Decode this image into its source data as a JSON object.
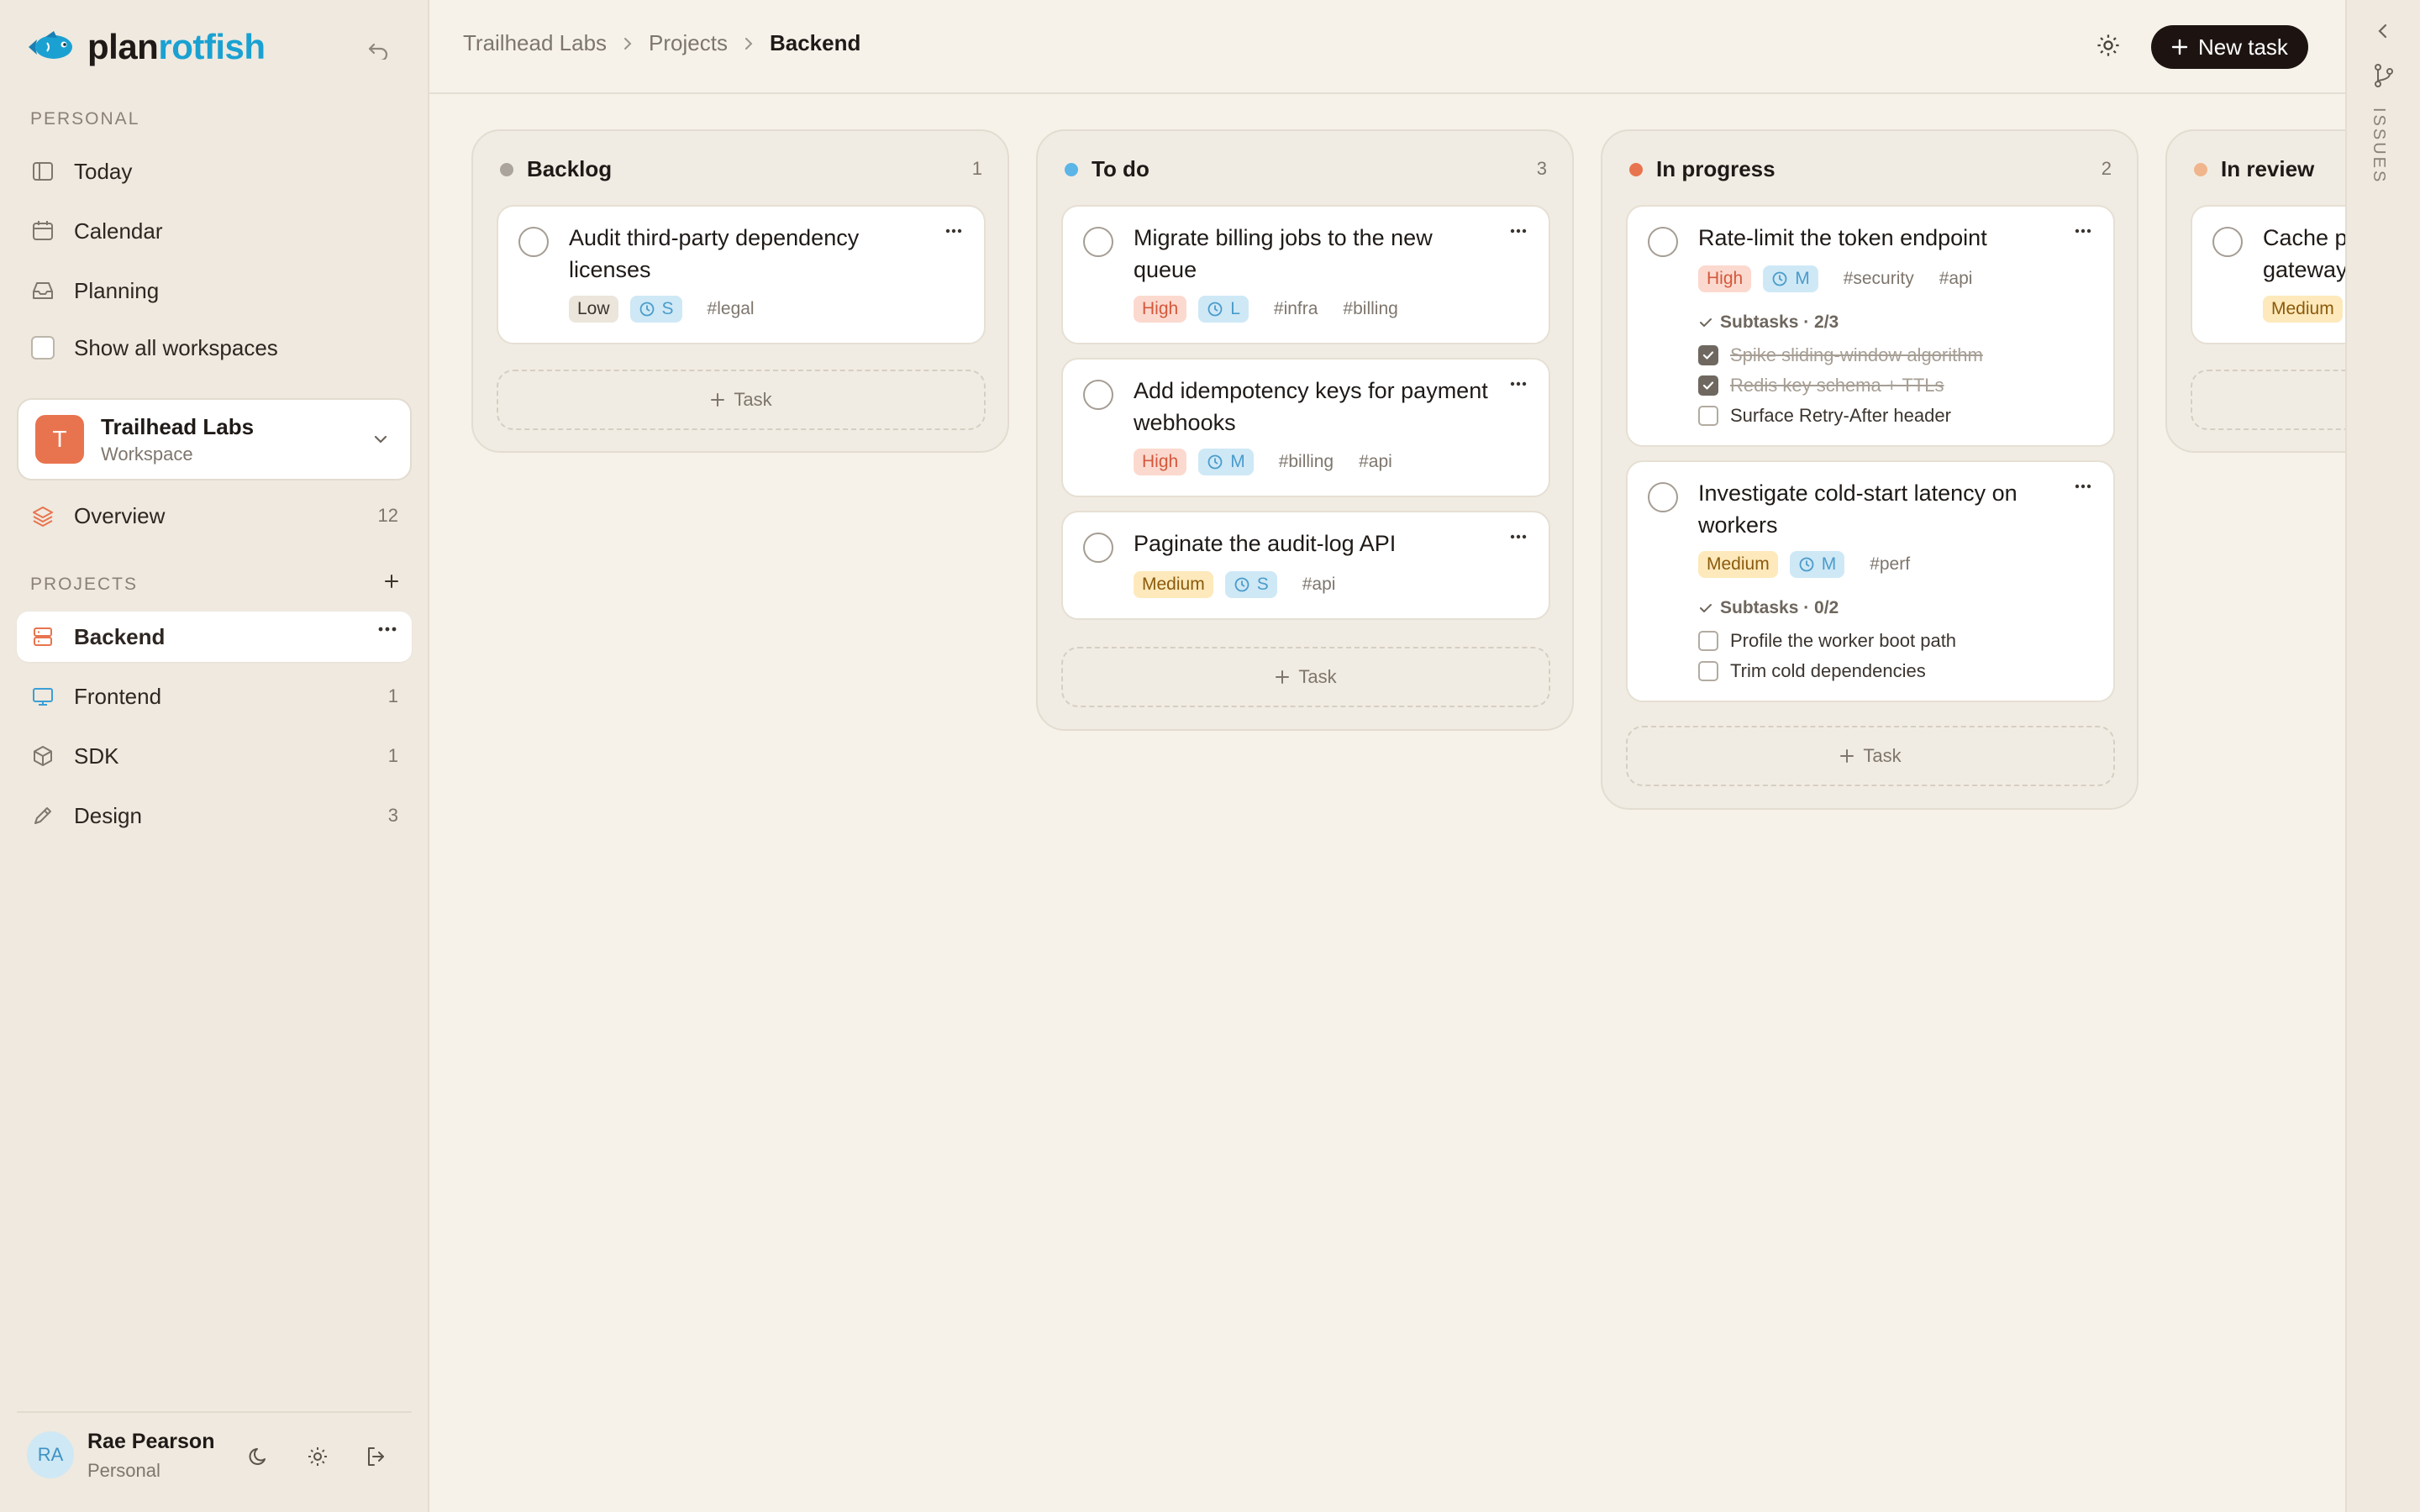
{
  "app": {
    "logo_part1": "plan",
    "logo_part2": "rotfish"
  },
  "sidebar": {
    "personal_label": "PERSONAL",
    "personal_items": [
      {
        "label": "Today",
        "icon": "sidebar-panel-icon"
      },
      {
        "label": "Calendar",
        "icon": "calendar-icon"
      },
      {
        "label": "Planning",
        "icon": "inbox-icon"
      }
    ],
    "show_all_label": "Show all workspaces",
    "workspace": {
      "initial": "T",
      "name": "Trailhead Labs",
      "type": "Workspace"
    },
    "overview": {
      "label": "Overview",
      "count": "12"
    },
    "projects_label": "PROJECTS",
    "projects": [
      {
        "label": "Backend",
        "count": ""
      },
      {
        "label": "Frontend",
        "count": "1"
      },
      {
        "label": "SDK",
        "count": "1"
      },
      {
        "label": "Design",
        "count": "3"
      }
    ],
    "user": {
      "initials": "RA",
      "name": "Rae Pearson",
      "sub": "Personal"
    }
  },
  "topbar": {
    "breadcrumb": [
      "Trailhead Labs",
      "Projects",
      "Backend"
    ],
    "new_task_label": "New task"
  },
  "rail": {
    "label": "ISSUES"
  },
  "columns": [
    {
      "title": "Backlog",
      "count": "1",
      "dot_color": "#aaa49c",
      "cards": [
        {
          "title": "Audit third-party dependency licenses",
          "priority": "Low",
          "size": "S",
          "tags": [
            "#legal"
          ]
        }
      ],
      "add_label": "Task"
    },
    {
      "title": "To do",
      "count": "3",
      "dot_color": "#5bb5e6",
      "cards": [
        {
          "title": "Migrate billing jobs to the new queue",
          "priority": "High",
          "size": "L",
          "tags": [
            "#infra",
            "#billing"
          ]
        },
        {
          "title": "Add idempotency keys for payment webhooks",
          "priority": "High",
          "size": "M",
          "tags": [
            "#billing",
            "#api"
          ]
        },
        {
          "title": "Paginate the audit-log API",
          "priority": "Medium",
          "size": "S",
          "tags": [
            "#api"
          ]
        }
      ],
      "add_label": "Task"
    },
    {
      "title": "In progress",
      "count": "2",
      "dot_color": "#e8744f",
      "cards": [
        {
          "title": "Rate-limit the token endpoint",
          "priority": "High",
          "size": "M",
          "tags": [
            "#security",
            "#api"
          ],
          "subtasks_label": "Subtasks · 2/3",
          "subtasks": [
            {
              "label": "Spike sliding-window algorithm",
              "done": true
            },
            {
              "label": "Redis key schema + TTLs",
              "done": true
            },
            {
              "label": "Surface Retry-After header",
              "done": false
            }
          ]
        },
        {
          "title": "Investigate cold-start latency on workers",
          "priority": "Medium",
          "size": "M",
          "tags": [
            "#perf"
          ],
          "subtasks_label": "Subtasks · 0/2",
          "subtasks": [
            {
              "label": "Profile the worker boot path",
              "done": false
            },
            {
              "label": "Trim cold dependencies",
              "done": false
            }
          ]
        }
      ],
      "add_label": "Task"
    },
    {
      "title": "In review",
      "count": "",
      "dot_color": "#f0b58c",
      "cards": [
        {
          "title_visible_line1": "Cache p",
          "title_visible_line2": "gateway",
          "priority": "Medium"
        }
      ]
    }
  ],
  "colors": {
    "accent_orange": "#e8744f",
    "brand_blue": "#1aa1d2",
    "button_dark": "#1d1412"
  }
}
